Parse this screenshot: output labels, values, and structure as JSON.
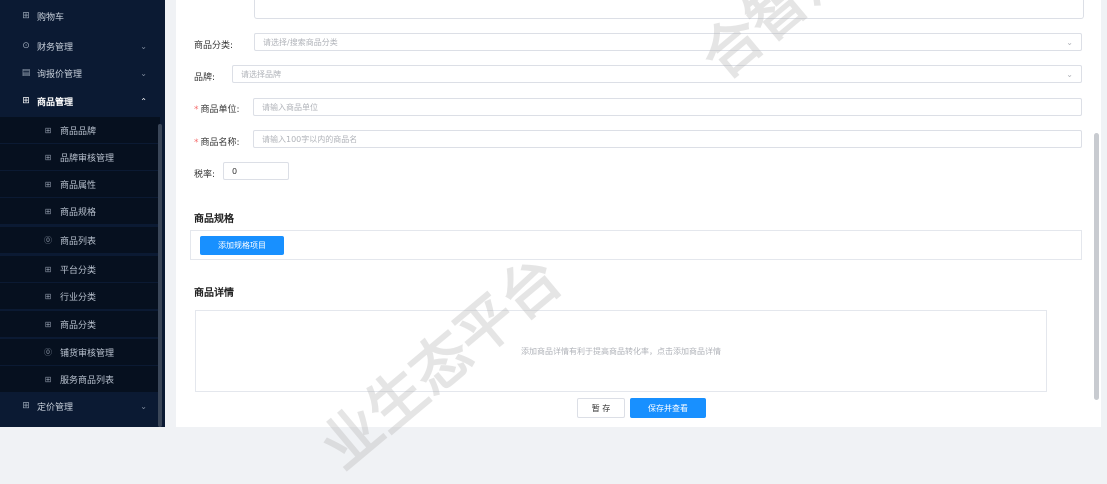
{
  "sidebar": {
    "items": [
      {
        "label": "购物车",
        "icon": "cart-icon",
        "glyph": "⊞"
      },
      {
        "label": "财务管理",
        "icon": "finance-icon",
        "glyph": "⊙",
        "chevron": "⌄"
      },
      {
        "label": "询报价管理",
        "icon": "chart-icon",
        "glyph": "▤",
        "chevron": "⌄"
      },
      {
        "label": "商品管理",
        "icon": "grid-icon",
        "glyph": "⊞",
        "chevron": "⌃"
      },
      {
        "label": "定价管理",
        "icon": "grid-icon",
        "glyph": "⊞",
        "chevron": "⌄"
      }
    ],
    "sub_items": [
      {
        "label": "商品品牌",
        "glyph": "⊞"
      },
      {
        "label": "品牌审核管理",
        "glyph": "⊞"
      },
      {
        "label": "商品属性",
        "glyph": "⊞"
      },
      {
        "label": "商品规格",
        "glyph": "⊞"
      },
      {
        "label": "商品列表",
        "glyph": "⓪"
      },
      {
        "label": "平台分类",
        "glyph": "⊞"
      },
      {
        "label": "行业分类",
        "glyph": "⊞"
      },
      {
        "label": "商品分类",
        "glyph": "⊞"
      },
      {
        "label": "铺货审核管理",
        "glyph": "⓪"
      },
      {
        "label": "服务商品列表",
        "glyph": "⊞"
      }
    ]
  },
  "form": {
    "category": {
      "label": "商品分类:",
      "placeholder": "请选择/搜索商品分类",
      "dropdown": "⌄"
    },
    "brand": {
      "label": "品牌:",
      "placeholder": "请选择品牌",
      "dropdown": "⌄"
    },
    "unit": {
      "required": "*",
      "label": "商品单位:",
      "placeholder": "请输入商品单位"
    },
    "name": {
      "required": "*",
      "label": "商品名称:",
      "placeholder": "请输入100字以内的商品名"
    },
    "tax": {
      "label": "税率:",
      "value": "0"
    }
  },
  "spec_section": {
    "title": "商品规格",
    "add_button": "添加规格项目"
  },
  "detail_section": {
    "title": "商品详情",
    "hint": "添加商品详情有利于提高商品转化率，点击添加商品详情"
  },
  "actions": {
    "save_draft": "暂 存",
    "save_view": "保存并查看"
  },
  "watermarks": [
    "合智汇",
    "业生态平台"
  ],
  "colors": {
    "sidebar_bg": "#0b1a33",
    "primary": "#1890ff",
    "required": "#f56c6c"
  }
}
